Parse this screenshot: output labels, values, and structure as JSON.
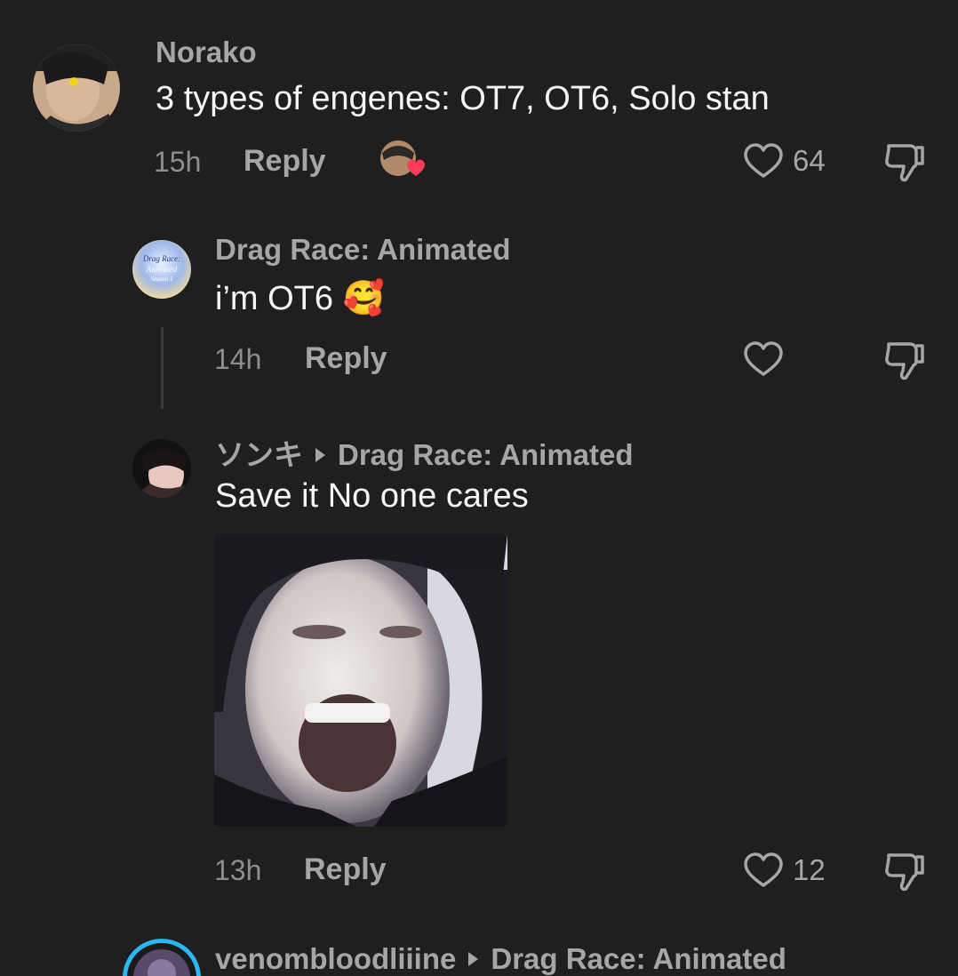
{
  "comments": [
    {
      "username": "Norako",
      "text": "3 types of engenes: OT7, OT6, Solo stan",
      "time": "15h",
      "reply_label": "Reply",
      "likes": "64"
    },
    {
      "username": "Drag Race: Animated",
      "avatar_text": [
        "Drag Race:",
        "Animated",
        "Season 1"
      ],
      "text": "i’m OT6 🥰",
      "time": "14h",
      "reply_label": "Reply",
      "likes": ""
    },
    {
      "username": "ソンキ",
      "reply_to": "Drag Race: Animated",
      "text": "Save it No one cares",
      "time": "13h",
      "reply_label": "Reply",
      "likes": "12"
    },
    {
      "username": "venombloodliiine",
      "reply_to": "Drag Race: Animated"
    }
  ],
  "colors": {
    "background": "#1f1f1f",
    "text_primary": "#f5f5f5",
    "text_secondary": "#a6a6a6",
    "heart_badge": "#ff3b5c",
    "story_ring": "#2bb8f0"
  }
}
